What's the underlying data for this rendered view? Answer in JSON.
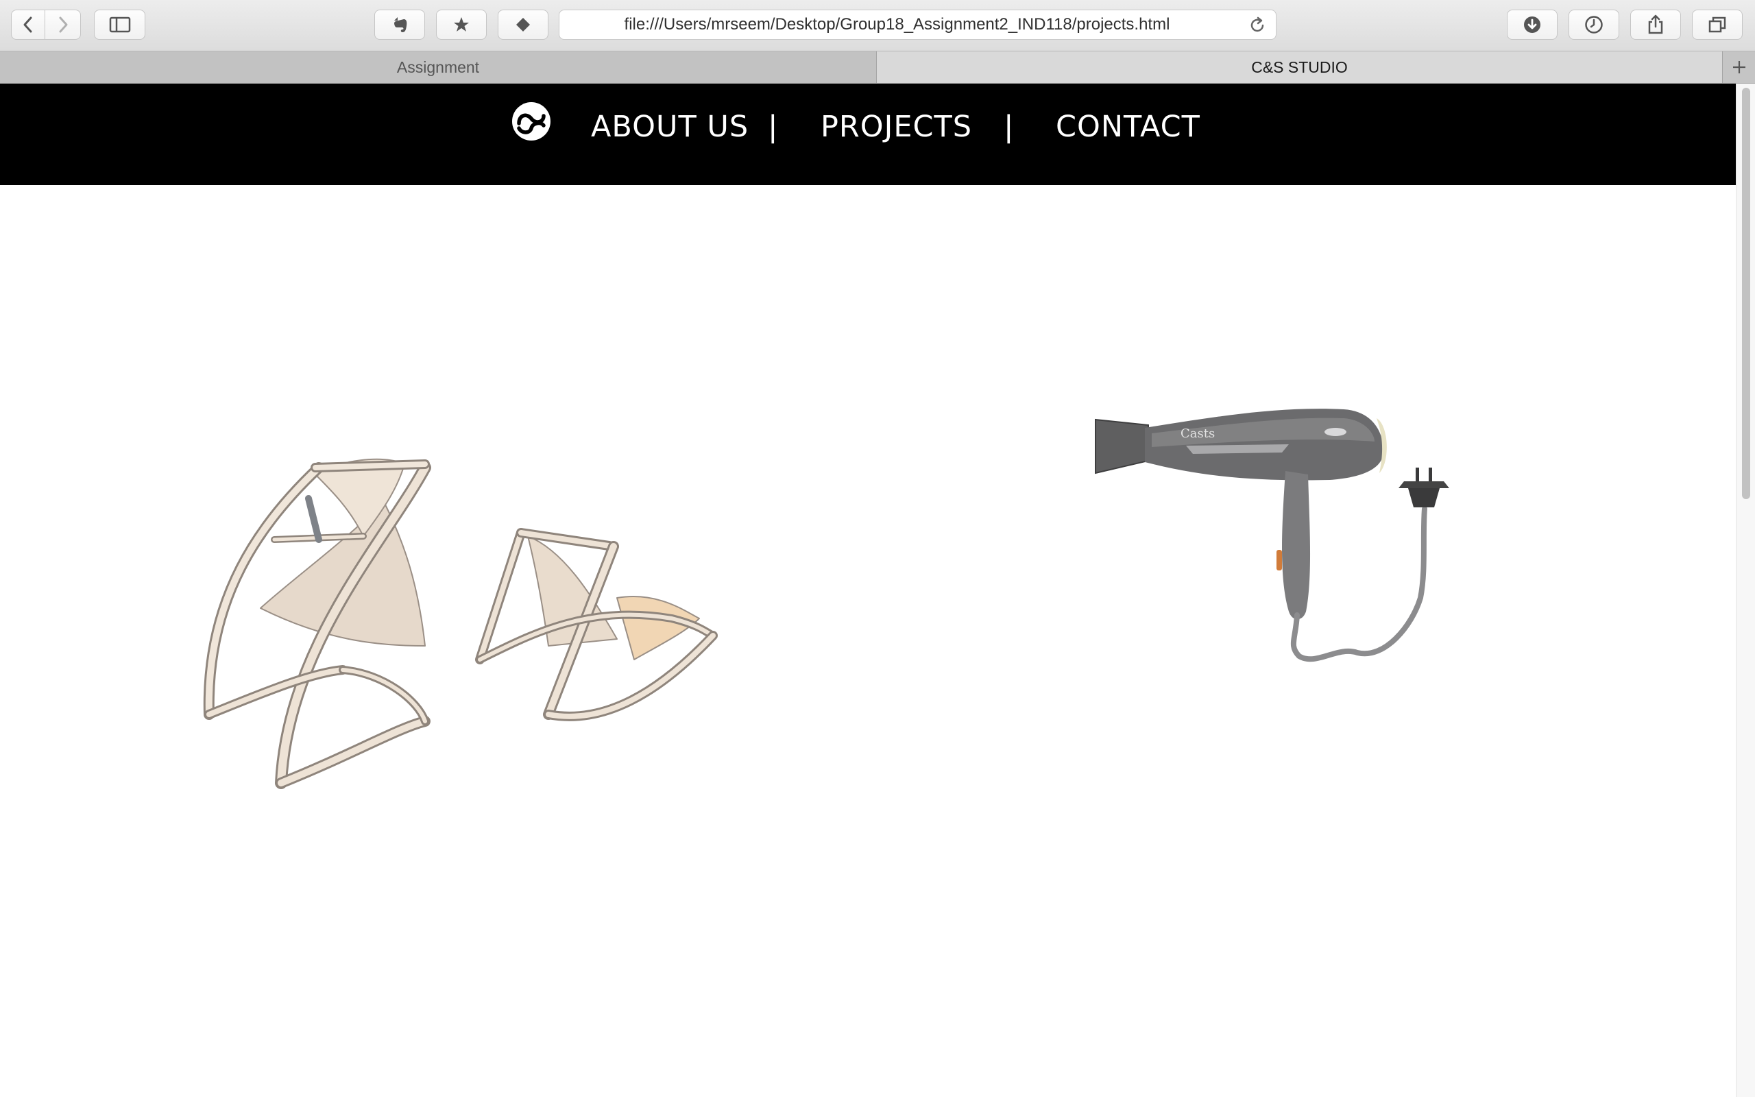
{
  "browser": {
    "url": "file:///Users/mrseem/Desktop/Group18_Assignment2_IND118/projects.html",
    "tabs": [
      {
        "label": "Assignment",
        "active": false
      },
      {
        "label": "C&S STUDIO",
        "active": true
      }
    ],
    "icons": {
      "back": "chevron-left-icon",
      "forward": "chevron-right-icon",
      "sidebar": "sidebar-icon",
      "extension": "evernote-icon",
      "bookmark": "star-icon",
      "tag": "diamond-icon",
      "reload": "reload-icon",
      "downloads": "download-icon",
      "history": "clock-icon",
      "share": "share-icon",
      "tabs_overview": "tabs-overview-icon",
      "new_tab": "plus-icon"
    }
  },
  "site": {
    "nav": {
      "items": [
        {
          "label": "ABOUT US"
        },
        {
          "label": "PROJECTS"
        },
        {
          "label": "CONTACT"
        }
      ],
      "separator": "|"
    },
    "projects": [
      {
        "name": "rocking-chair-sketch"
      },
      {
        "name": "hair-dryer-render"
      }
    ]
  },
  "colors": {
    "nav_background": "#000000",
    "nav_text": "#ffffff",
    "page_background": "#ffffff"
  }
}
